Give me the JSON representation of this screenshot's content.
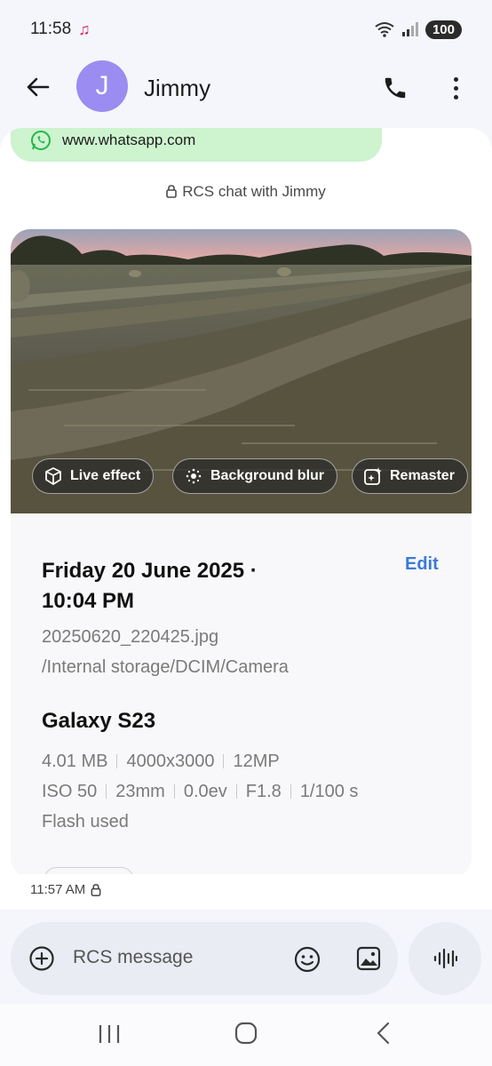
{
  "status_bar": {
    "time": "11:58",
    "battery": "100"
  },
  "header": {
    "avatar_initial": "J",
    "contact_name": "Jimmy"
  },
  "chat": {
    "link_text": "www.whatsapp.com",
    "rcs_label": "RCS chat with Jimmy",
    "photo_chips": {
      "live_effect": "Live effect",
      "background_blur": "Background blur",
      "remaster": "Remaster"
    },
    "photo_info": {
      "date_line1": "Friday 20 June 2025 ·",
      "date_line2": "10:04 PM",
      "edit_label": "Edit",
      "filename": "20250620_220425.jpg",
      "path": "/Internal storage/DCIM/Camera",
      "device": "Galaxy S23",
      "file_size": "4.01 MB",
      "resolution": "4000x3000",
      "megapixels": "12MP",
      "iso": "ISO 50",
      "focal_length": "23mm",
      "exposure_value": "0.0ev",
      "aperture": "F1.8",
      "shutter": "1/100 s",
      "flash": "Flash used"
    },
    "timestamp": "11:57 AM"
  },
  "composer": {
    "placeholder": "RCS message"
  },
  "colors": {
    "accent": "#3b7bd6",
    "avatar": "#9a8cf0",
    "link_bubble": "#cdf3cf",
    "composer_bg": "#e9ecf3"
  }
}
